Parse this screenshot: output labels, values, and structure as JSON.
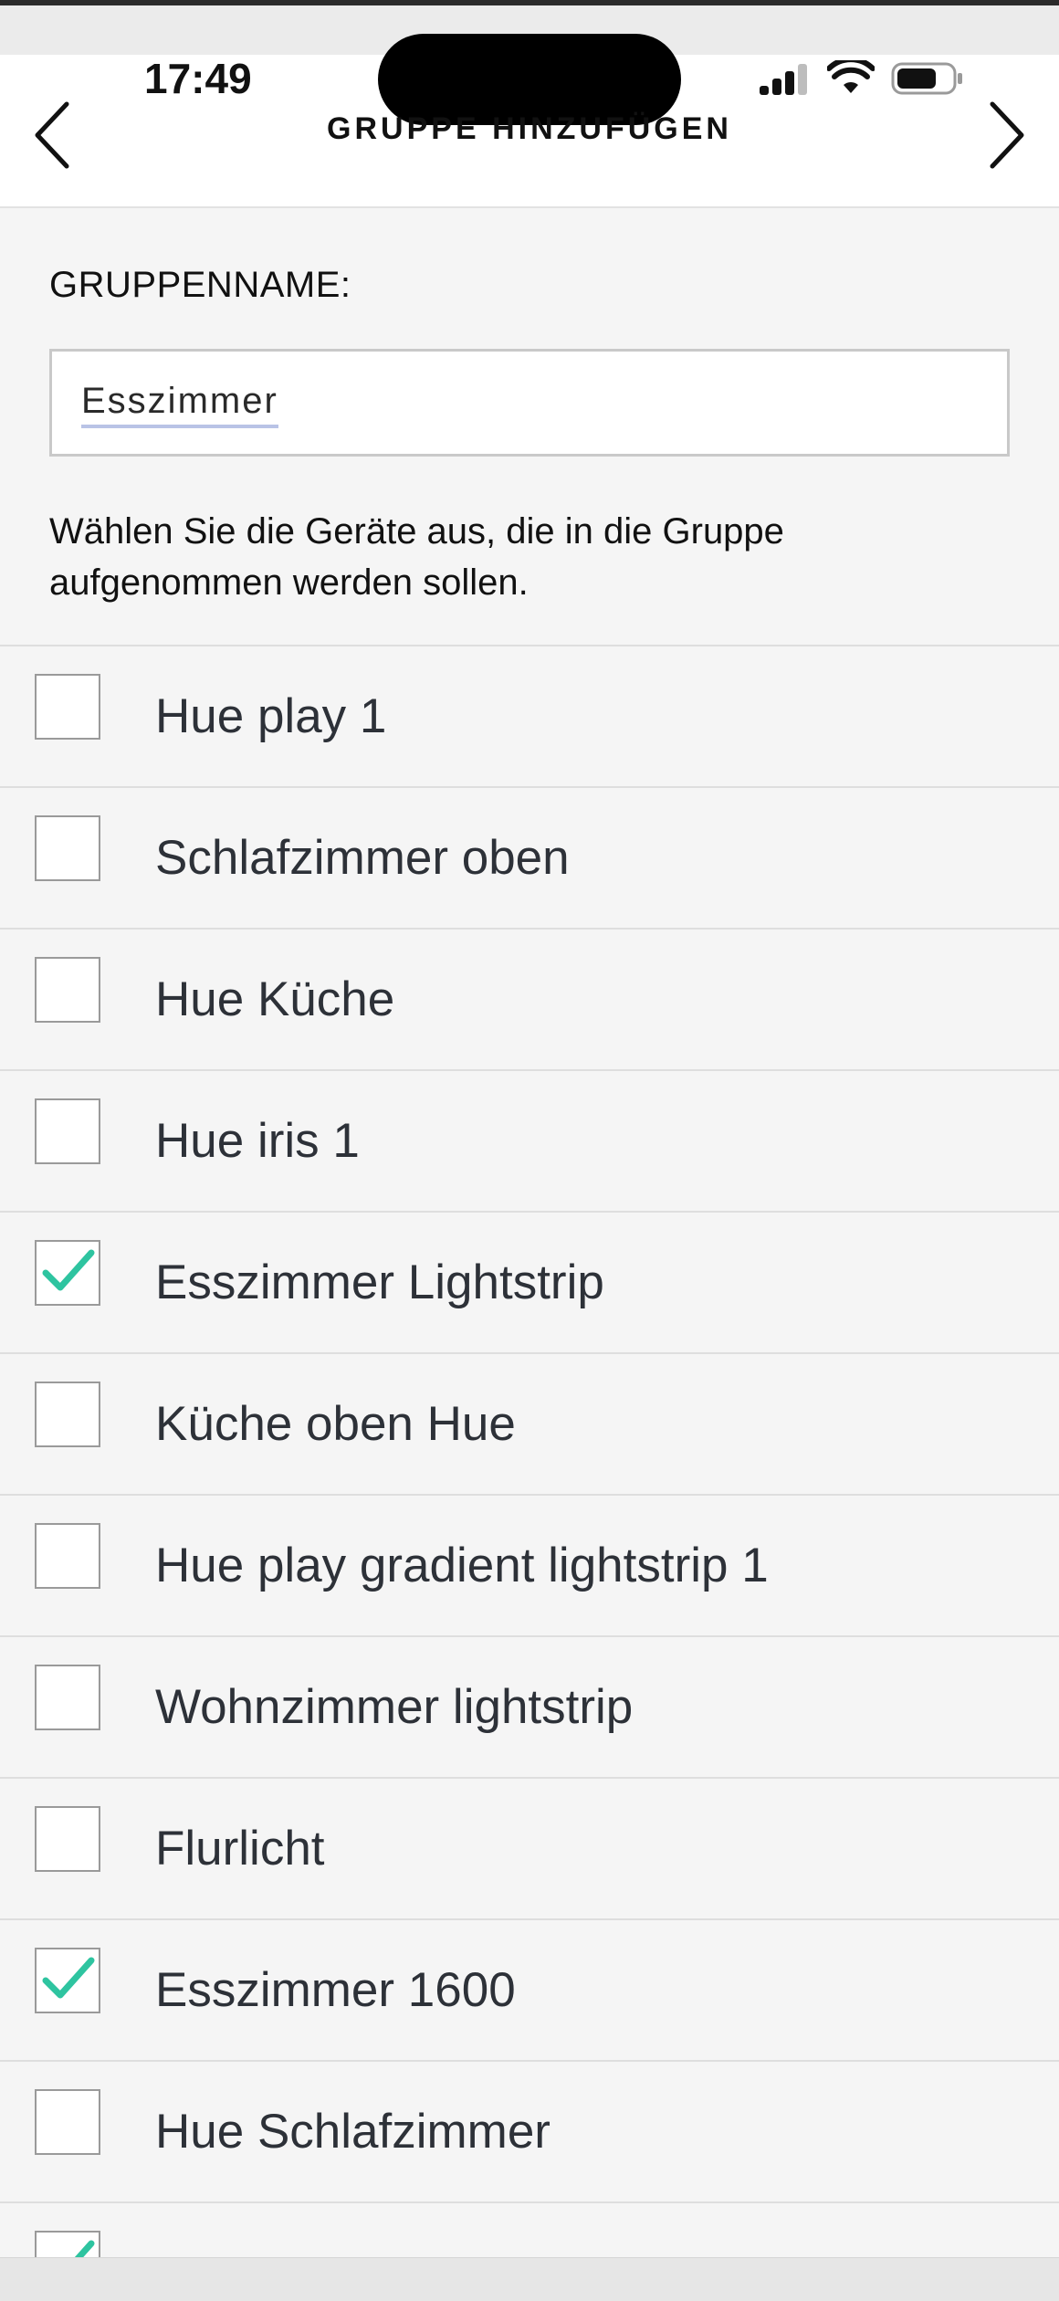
{
  "status_bar": {
    "time": "17:49"
  },
  "nav": {
    "title": "GRUPPE HINZUFÜGEN",
    "back_icon": "chevron-left-icon",
    "forward_icon": "chevron-right-icon"
  },
  "form": {
    "group_name_label": "GRUPPENNAME:",
    "group_name_value": "Esszimmer",
    "instructions": "Wählen Sie die Geräte aus, die in die Gruppe aufgenommen werden sollen."
  },
  "devices": [
    {
      "label": "Hue play 1",
      "checked": false
    },
    {
      "label": "Schlafzimmer oben",
      "checked": false
    },
    {
      "label": "Hue Küche",
      "checked": false
    },
    {
      "label": "Hue iris 1",
      "checked": false
    },
    {
      "label": "Esszimmer Lightstrip",
      "checked": true
    },
    {
      "label": "Küche oben Hue",
      "checked": false
    },
    {
      "label": "Hue play gradient lightstrip 1",
      "checked": false
    },
    {
      "label": "Wohnzimmer lightstrip",
      "checked": false
    },
    {
      "label": "Flurlicht",
      "checked": false
    },
    {
      "label": "Esszimmer 1600",
      "checked": true
    },
    {
      "label": "Hue Schlafzimmer",
      "checked": false
    },
    {
      "label": "",
      "checked": true
    }
  ],
  "colors": {
    "check_accent": "#2ec4a0",
    "background": "#f5f5f5",
    "header": "#ffffff"
  }
}
